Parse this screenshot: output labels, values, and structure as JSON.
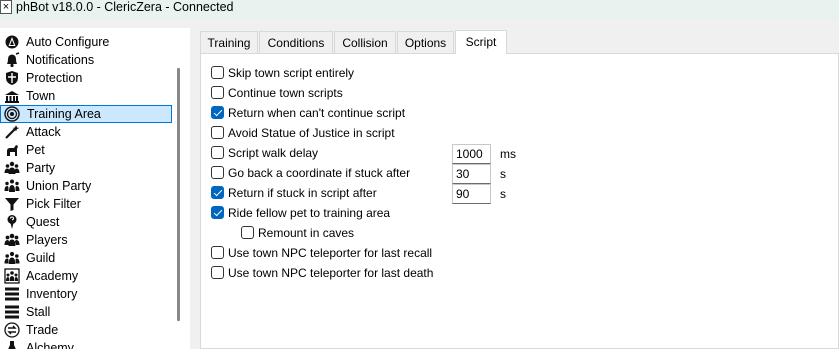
{
  "window": {
    "title": "phBot v18.0.0 - ClericZera - Connected",
    "icon": "close-x-icon"
  },
  "sidebar": {
    "items": [
      {
        "label": "Auto Configure",
        "icon": "auto-configure-icon"
      },
      {
        "label": "Notifications",
        "icon": "bell-icon"
      },
      {
        "label": "Protection",
        "icon": "shield-icon"
      },
      {
        "label": "Town",
        "icon": "town-icon"
      },
      {
        "label": "Training Area",
        "icon": "target-icon",
        "selected": true
      },
      {
        "label": "Attack",
        "icon": "wand-icon"
      },
      {
        "label": "Pet",
        "icon": "pet-icon"
      },
      {
        "label": "Party",
        "icon": "party-icon"
      },
      {
        "label": "Union Party",
        "icon": "union-party-icon"
      },
      {
        "label": "Pick Filter",
        "icon": "filter-icon"
      },
      {
        "label": "Quest",
        "icon": "quest-icon"
      },
      {
        "label": "Players",
        "icon": "players-icon"
      },
      {
        "label": "Guild",
        "icon": "guild-icon"
      },
      {
        "label": "Academy",
        "icon": "academy-icon"
      },
      {
        "label": "Inventory",
        "icon": "inventory-icon"
      },
      {
        "label": "Stall",
        "icon": "stall-icon"
      },
      {
        "label": "Trade",
        "icon": "trade-icon"
      },
      {
        "label": "Alchemy",
        "icon": "alchemy-icon"
      }
    ]
  },
  "tabs": [
    {
      "label": "Training"
    },
    {
      "label": "Conditions"
    },
    {
      "label": "Collision"
    },
    {
      "label": "Options"
    },
    {
      "label": "Script",
      "active": true
    }
  ],
  "script_options": {
    "skip_town_script": {
      "label": "Skip town script entirely",
      "checked": false
    },
    "continue_town_scripts": {
      "label": "Continue town scripts",
      "checked": false
    },
    "return_cant_continue": {
      "label": "Return when can't continue script",
      "checked": true
    },
    "avoid_statue": {
      "label": "Avoid Statue of Justice in script",
      "checked": false
    },
    "script_walk_delay": {
      "label": "Script walk delay",
      "checked": false,
      "value": "1000",
      "unit": "ms"
    },
    "go_back_coordinate": {
      "label": "Go back a coordinate if stuck after",
      "checked": false,
      "value": "30",
      "unit": "s"
    },
    "return_if_stuck": {
      "label": "Return if stuck in script after",
      "checked": true,
      "value": "90",
      "unit": "s"
    },
    "ride_fellow_pet": {
      "label": "Ride fellow pet to training area",
      "checked": true
    },
    "remount_in_caves": {
      "label": "Remount in caves",
      "checked": false
    },
    "npc_teleporter_recall": {
      "label": "Use town NPC teleporter for last recall",
      "checked": false
    },
    "npc_teleporter_death": {
      "label": "Use town NPC teleporter for last death",
      "checked": false
    }
  }
}
